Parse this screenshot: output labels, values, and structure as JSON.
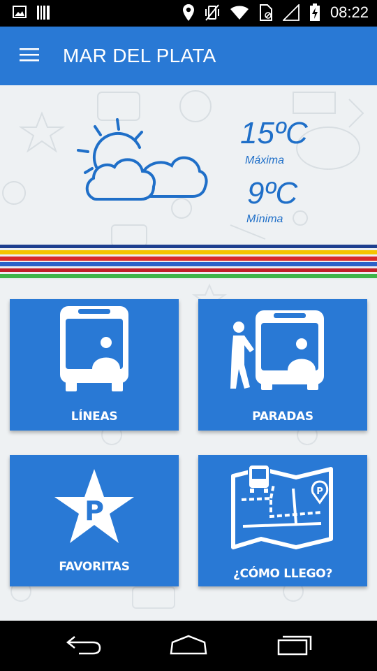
{
  "status_bar": {
    "time": "08:22",
    "left_icons": [
      "image-icon",
      "barcode-icon"
    ],
    "right_icons": [
      "location-icon",
      "vibrate-off-icon",
      "wifi-icon",
      "sim-icon",
      "signal-icon",
      "battery-icon"
    ]
  },
  "app_bar": {
    "title": "MAR DEL PLATA",
    "menu_icon": "hamburger-menu-icon"
  },
  "weather": {
    "icon": "partly-cloudy-icon",
    "max_temp": "15ºC",
    "max_label": "Máxima",
    "min_temp": "9ºC",
    "min_label": "Mínima"
  },
  "stripe_colors": [
    "#1d3f8f",
    "#f5c400",
    "#d8292a",
    "#2b62c8",
    "#ffffff",
    "#c01f28",
    "#3eb649"
  ],
  "tiles": [
    {
      "label": "LÍNEAS",
      "icon": "bus-driver-icon"
    },
    {
      "label": "PARADAS",
      "icon": "bus-stop-icon"
    },
    {
      "label": "FAVORITAS",
      "icon": "star-parking-icon"
    },
    {
      "label": "¿CÓMO LLEGO?",
      "icon": "route-map-icon"
    }
  ],
  "nav_bar": {
    "buttons": [
      "back-icon",
      "home-icon",
      "recents-icon"
    ]
  },
  "colors": {
    "primary": "#2979d5",
    "weather_text": "#1f6fc8",
    "background": "#eef1f3"
  }
}
